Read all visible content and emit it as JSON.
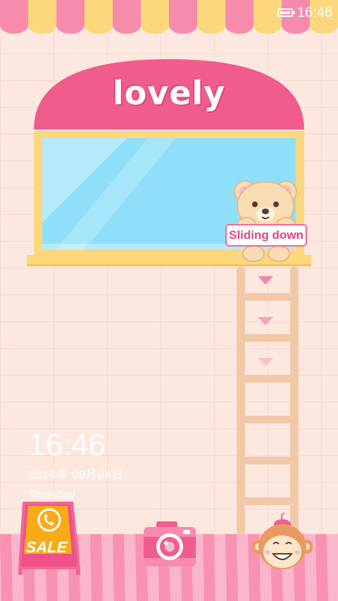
{
  "status_bar": {
    "time": "16:46",
    "battery_icon": "battery-icon"
  },
  "shop": {
    "sign": "lovely"
  },
  "bear": {
    "label": "Sliding down"
  },
  "clock": {
    "time": "16:46",
    "date": "2014年  09月04日",
    "day": "Thursday"
  },
  "shortcuts": {
    "phone": {
      "label": "SALE",
      "icon": "phone-icon"
    },
    "camera": {
      "icon": "camera-icon"
    },
    "monkey": {
      "icon": "monkey-face-icon"
    }
  },
  "colors": {
    "wall": "#fde8e0",
    "awning_pink": "#f78bac",
    "awning_yellow": "#fcd77b",
    "dome": "#f05d8c",
    "glass": "#8fdffa",
    "ladder": "#f1c9a8",
    "sale_orange": "#f9ab17"
  }
}
